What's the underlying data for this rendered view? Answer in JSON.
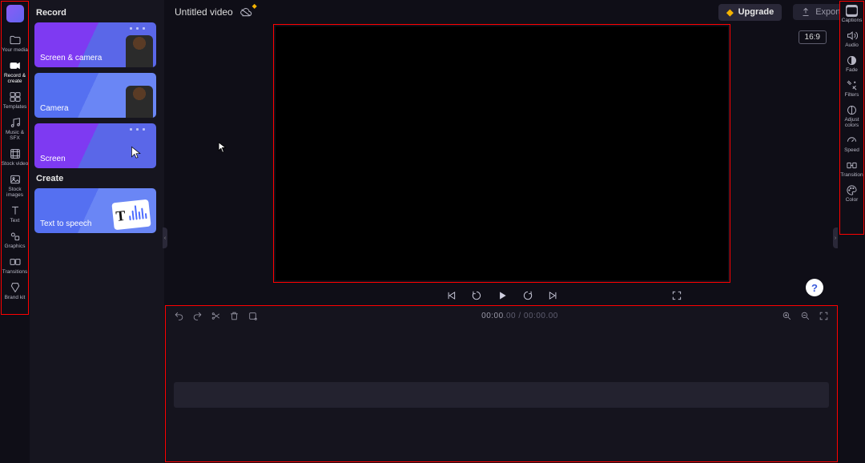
{
  "header": {
    "title": "Untitled video",
    "upgrade_label": "Upgrade",
    "export_label": "Export"
  },
  "aspect_ratio": "16:9",
  "left_rail": {
    "items": [
      {
        "id": "your-media",
        "label": "Your media"
      },
      {
        "id": "record-create",
        "label": "Record & create",
        "active": true
      },
      {
        "id": "templates",
        "label": "Templates"
      },
      {
        "id": "music-sfx",
        "label": "Music & SFX"
      },
      {
        "id": "stock-video",
        "label": "Stock video"
      },
      {
        "id": "stock-images",
        "label": "Stock images"
      },
      {
        "id": "text",
        "label": "Text"
      },
      {
        "id": "graphics",
        "label": "Graphics"
      },
      {
        "id": "transitions",
        "label": "Transitions"
      },
      {
        "id": "brand-kit",
        "label": "Brand kit"
      }
    ]
  },
  "panel": {
    "record_heading": "Record",
    "create_heading": "Create",
    "cards": {
      "screen_camera": "Screen & camera",
      "camera": "Camera",
      "screen": "Screen",
      "tts": "Text to speech"
    }
  },
  "right_rail": {
    "items": [
      {
        "id": "captions",
        "label": "Captions"
      },
      {
        "id": "audio",
        "label": "Audio"
      },
      {
        "id": "fade",
        "label": "Fade"
      },
      {
        "id": "filters",
        "label": "Filters"
      },
      {
        "id": "adjust-colors",
        "label": "Adjust colors"
      },
      {
        "id": "speed",
        "label": "Speed"
      },
      {
        "id": "transition",
        "label": "Transition"
      },
      {
        "id": "color",
        "label": "Color"
      }
    ]
  },
  "timeline": {
    "current": "00:00",
    "current_frames": ".00",
    "sep": " / ",
    "total": "00:00",
    "total_frames": ".00"
  },
  "help": "?"
}
